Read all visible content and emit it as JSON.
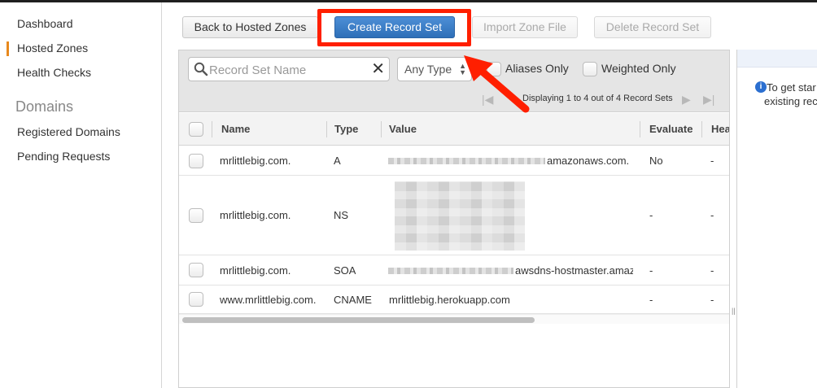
{
  "sidebar": {
    "items": [
      {
        "label": "Dashboard"
      },
      {
        "label": "Hosted Zones",
        "active": true
      },
      {
        "label": "Health Checks"
      }
    ],
    "section_heading": "Domains",
    "section_items": [
      {
        "label": "Registered Domains"
      },
      {
        "label": "Pending Requests"
      }
    ],
    "active_color": "#e8891d"
  },
  "toolbar": {
    "back_label": "Back to Hosted Zones",
    "create_label": "Create Record Set",
    "import_label": "Import Zone File",
    "delete_label": "Delete Record Set",
    "highlight_color": "#ff1f00"
  },
  "filters": {
    "search_placeholder": "Record Set Name",
    "type_selected": "Any Type",
    "aliases_label": "Aliases Only",
    "weighted_label": "Weighted Only"
  },
  "pager": {
    "text": "Displaying 1 to 4 out of 4 Record Sets"
  },
  "table": {
    "columns": [
      "Name",
      "Type",
      "Value",
      "Evaluate",
      "Hea"
    ],
    "rows": [
      {
        "name": "mrlittlebig.com.",
        "type": "A",
        "value": "amazonaws.com.",
        "evaluate": "No",
        "health": "-"
      },
      {
        "name": "mrlittlebig.com.",
        "type": "NS",
        "value": "",
        "evaluate": "-",
        "health": "-"
      },
      {
        "name": "mrlittlebig.com.",
        "type": "SOA",
        "value": "awsdns-hostmaster.amaz",
        "evaluate": "-",
        "health": "-"
      },
      {
        "name": "www.mrlittlebig.com.",
        "type": "CNAME",
        "value": "mrlittlebig.herokuapp.com",
        "evaluate": "-",
        "health": "-"
      }
    ]
  },
  "help": {
    "line1": "To get star",
    "line2": "existing rec"
  }
}
